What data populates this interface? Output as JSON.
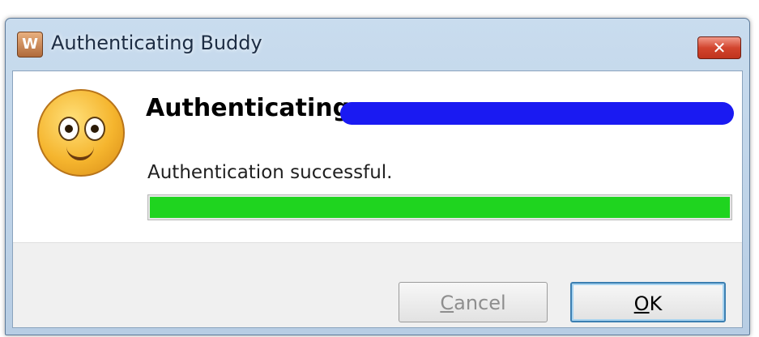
{
  "window": {
    "title": "Authenticating Buddy",
    "app_icon_glyph": "W",
    "close_glyph": "✕"
  },
  "content": {
    "heading": "Authenticating",
    "status": "Authentication successful.",
    "progress_fraction": 1.0,
    "progress_color": "#1fd41f",
    "redaction_color": "#1a1af2",
    "icon": "smiley-face-icon"
  },
  "buttons": {
    "cancel_mnemonic": "C",
    "cancel_rest": "ancel",
    "ok_mnemonic": "O",
    "ok_rest": "K"
  }
}
